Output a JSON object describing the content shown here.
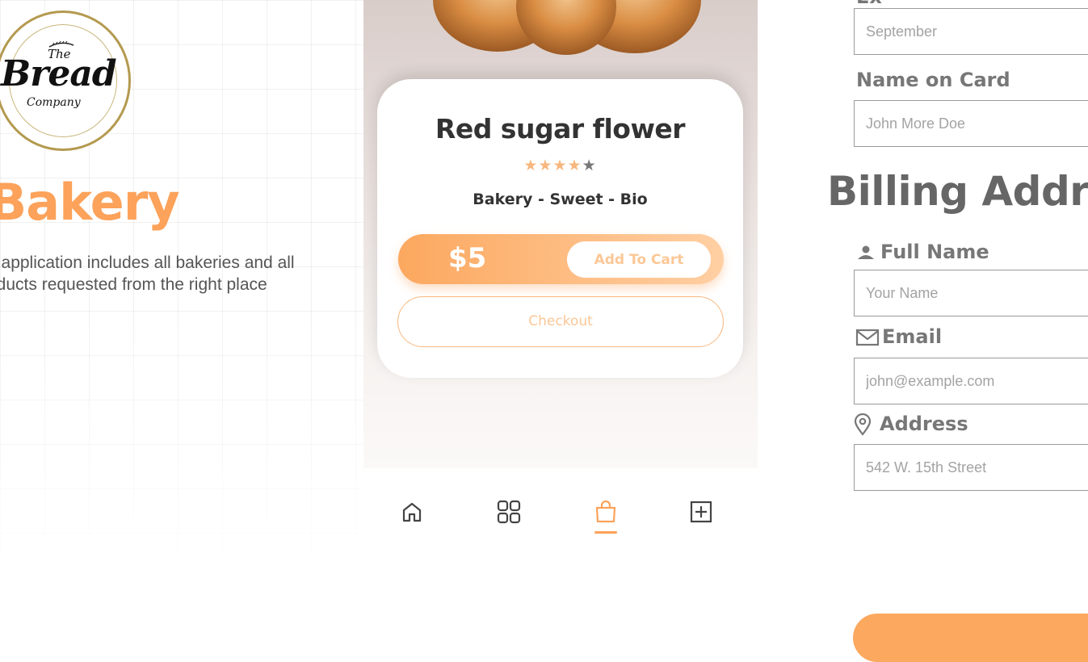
{
  "brand": {
    "logo_the": "The",
    "logo_bread": "Bread",
    "logo_company": "Company",
    "title": "Bakery",
    "description": "e application includes all bakeries and all\noducts requested from the right place",
    "accent_color": "#fca25a"
  },
  "product": {
    "name": "Red sugar flower",
    "rating": 4,
    "rating_max": 5,
    "tags": "Bakery - Sweet - Bio",
    "price": "$5",
    "add_to_cart_label": "Add To Cart",
    "checkout_label": "Checkout"
  },
  "bottom_nav": {
    "items": [
      {
        "icon": "home-icon",
        "active": false
      },
      {
        "icon": "grid-icon",
        "active": false
      },
      {
        "icon": "shopping-bag-icon",
        "active": true
      },
      {
        "icon": "plus-square-icon",
        "active": false
      }
    ]
  },
  "payment_form": {
    "expiry_month_placeholder": "September",
    "name_on_card_label": "Name on Card",
    "name_on_card_placeholder": "John More Doe"
  },
  "billing": {
    "title": "Billing Addre",
    "full_name_label": "Full Name",
    "full_name_placeholder": "Your Name",
    "email_label": "Email",
    "email_placeholder": "john@example.com",
    "address_label": "Address",
    "address_placeholder": "542 W. 15th Street"
  }
}
